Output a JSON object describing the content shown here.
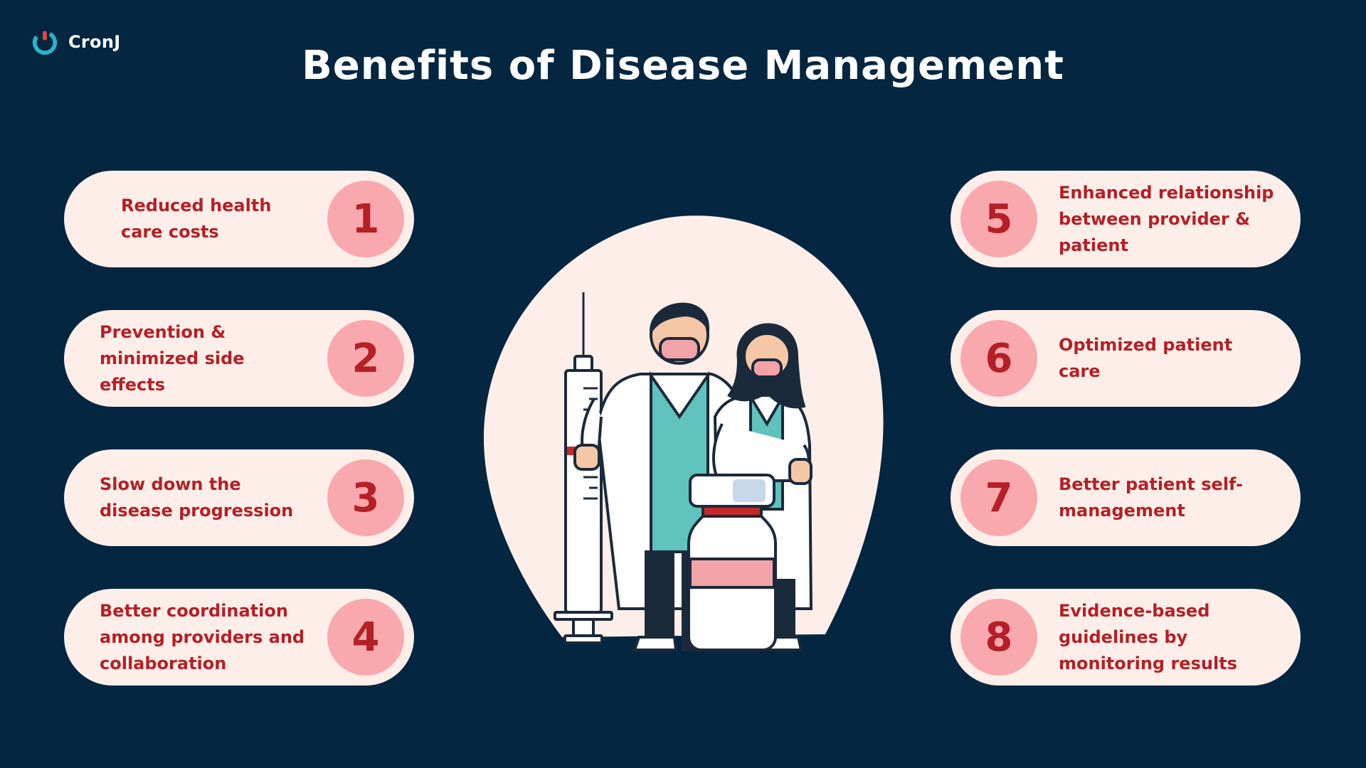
{
  "brand": {
    "name": "CronJ",
    "logo_icon": "cronj-logo-icon"
  },
  "title": "Benefits of Disease Management",
  "colors": {
    "background": "#042640",
    "pill": "#fdeee9",
    "badge": "#f9a8ae",
    "accent_text": "#b42026",
    "logo_teal": "#2bb3c9"
  },
  "benefits_left": [
    {
      "number": "1",
      "text": "Reduced health care costs"
    },
    {
      "number": "2",
      "text": "Prevention & minimized side effects"
    },
    {
      "number": "3",
      "text": "Slow down the disease progression"
    },
    {
      "number": "4",
      "text": "Better coordination among providers and collaboration"
    }
  ],
  "benefits_right": [
    {
      "number": "5",
      "text": "Enhanced relationship between provider & patient"
    },
    {
      "number": "6",
      "text": "Optimized patient care"
    },
    {
      "number": "7",
      "text": "Better patient self-management"
    },
    {
      "number": "8",
      "text": "Evidence-based guidelines by monitoring results"
    }
  ],
  "illustration": {
    "icon": "doctors-with-syringe-and-vial-illustration"
  }
}
